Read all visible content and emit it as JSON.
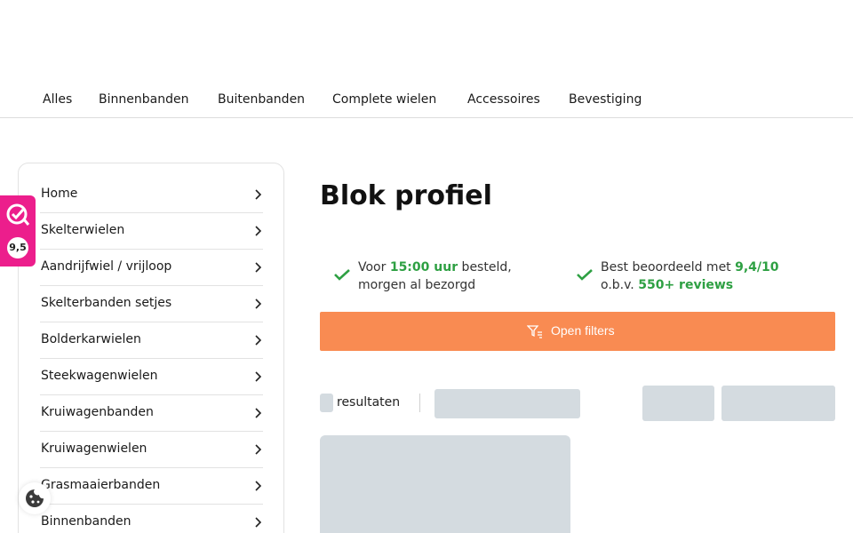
{
  "topnav": {
    "tabs": [
      {
        "label": "Alles"
      },
      {
        "label": "Binnenbanden"
      },
      {
        "label": "Buitenbanden"
      },
      {
        "label": "Complete wielen"
      },
      {
        "label": "Accessoires"
      },
      {
        "label": "Bevestiging"
      }
    ]
  },
  "sidebar": {
    "categories": [
      {
        "label": "Home"
      },
      {
        "label": "Skelterwielen"
      },
      {
        "label": "Aandrijfwiel / vrijloop"
      },
      {
        "label": "Skelterbanden setjes"
      },
      {
        "label": "Bolderkarwielen"
      },
      {
        "label": "Steekwagenwielen"
      },
      {
        "label": "Kruiwagenbanden"
      },
      {
        "label": "Kruiwagenwielen"
      },
      {
        "label": "Grasmaaierbanden"
      },
      {
        "label": "Binnenbanden"
      }
    ]
  },
  "rating_badge": {
    "score": "9,5",
    "color": "#ec1e8c"
  },
  "main": {
    "title": "Blok profiel",
    "usps": [
      {
        "pre": "Voor ",
        "highlight": "15:00 uur",
        "post": " besteld,",
        "line2_pre": "morgen al bezorgd",
        "line2_highlight": "",
        "icon": "check-icon"
      },
      {
        "pre": "Best beoordeeld met ",
        "highlight": "9,4/10",
        "post": "",
        "line2_pre": "o.b.v. ",
        "line2_highlight": "550+ reviews",
        "icon": "check-icon"
      }
    ],
    "filter_button": {
      "label": "Open filters",
      "color": "#f98b52",
      "icon": "filter-icon"
    },
    "results": {
      "label": "resultaten"
    }
  },
  "colors": {
    "accent_green": "#2ea043",
    "placeholder": "#d4dbe0"
  }
}
